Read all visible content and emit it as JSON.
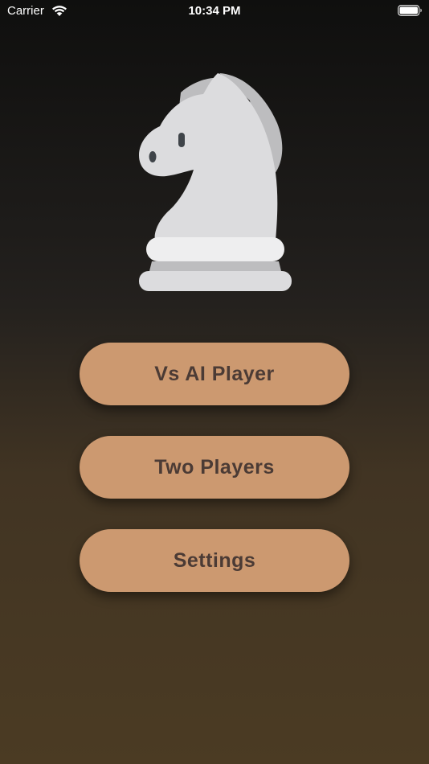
{
  "status_bar": {
    "carrier": "Carrier",
    "time": "10:34 PM",
    "icons": [
      "wifi-icon",
      "battery-icon"
    ]
  },
  "hero": {
    "icon": "chess-knight-icon"
  },
  "menu": {
    "buttons": [
      {
        "label": "Vs AI Player"
      },
      {
        "label": "Two Players"
      },
      {
        "label": "Settings"
      }
    ]
  },
  "colors": {
    "button_background": "#cc9970",
    "button_text": "#4b3b35",
    "background_top": "#0f0f0e",
    "background_bottom": "#4b3b23",
    "knight_light": "#dcdcde",
    "knight_shade": "#bdbdbf",
    "knight_eye": "#3f4449"
  }
}
